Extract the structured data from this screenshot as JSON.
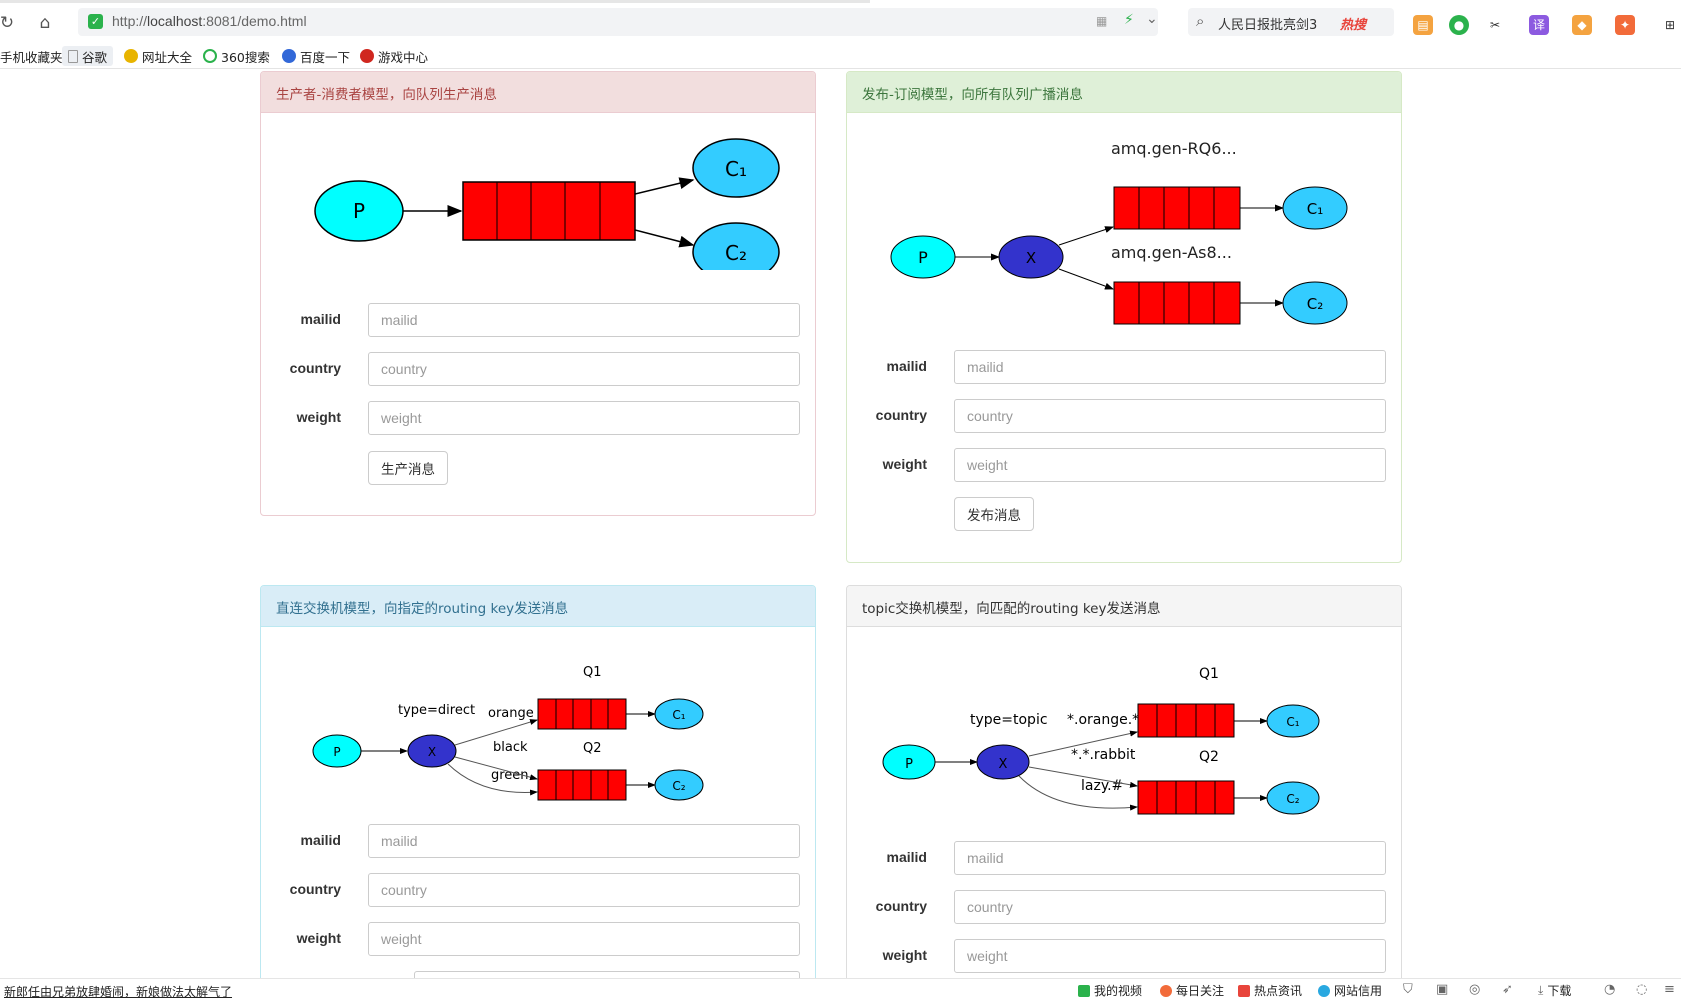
{
  "browser": {
    "url_prefix": "http://",
    "url_host": "localhost",
    "url_rest": ":8081/demo.html",
    "search_query": "人民日报批亮剑3",
    "search_hot": "热搜"
  },
  "bookmarks": [
    "手机收藏夹",
    "谷歌",
    "网址大全",
    "360搜索",
    "百度一下",
    "游戏中心"
  ],
  "panels": {
    "producer": {
      "title": "生产者-消费者模型，向队列生产消息",
      "button": "生产消息",
      "diagram": {
        "p": "P",
        "c1": "C₁",
        "c2": "C₂"
      }
    },
    "publish": {
      "title": "发布-订阅模型，向所有队列广播消息",
      "button": "发布消息",
      "diagram": {
        "p": "P",
        "x": "X",
        "q1": "amq.gen-RQ6...",
        "q2": "amq.gen-As8...",
        "c1": "C₁",
        "c2": "C₂"
      }
    },
    "direct": {
      "title": "直连交换机模型，向指定的routing key发送消息",
      "diagram": {
        "p": "P",
        "x": "X",
        "type": "type=direct",
        "k1": "orange",
        "k2": "black",
        "k3": "green",
        "q1": "Q1",
        "q2": "Q2",
        "c1": "C₁",
        "c2": "C₂"
      }
    },
    "topic": {
      "title": "topic交换机模型，向匹配的routing key发送消息",
      "diagram": {
        "p": "P",
        "x": "X",
        "type": "type=topic",
        "k1": "*.orange.*",
        "k2": "*.*.rabbit",
        "k3": "lazy.#",
        "q1": "Q1",
        "q2": "Q2",
        "c1": "C₁",
        "c2": "C₂"
      }
    }
  },
  "form": {
    "mailid_label": "mailid",
    "country_label": "country",
    "weight_label": "weight",
    "mailid_placeholder": "mailid",
    "country_placeholder": "country",
    "weight_placeholder": "weight"
  },
  "statusbar": {
    "news": "新郎任由兄弟放肆婚闹，新娘做法太解气了",
    "items": [
      "我的视频",
      "每日关注",
      "热点资讯",
      "网站信用",
      "下载"
    ]
  },
  "colors": {
    "queue": "#ff0000",
    "producer": "#00ffff",
    "consumer": "#33ccff",
    "exchange": "#3333cc"
  }
}
